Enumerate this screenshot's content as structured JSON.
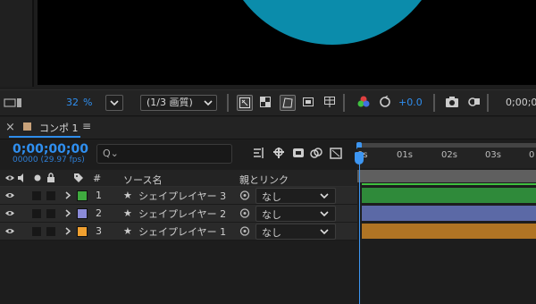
{
  "viewer_toolbar": {
    "zoom_value": "32",
    "zoom_unit": "%",
    "resolution": "(1/3 画質)",
    "exposure": "+0.0",
    "timecode": "0;00;00"
  },
  "panel": {
    "tab_label": "コンポ 1",
    "menu_glyph": "≡",
    "close_glyph": "×"
  },
  "time": {
    "current": "0;00;00;00",
    "frames": "00000 (29.97 fps)"
  },
  "search": {
    "placeholder": "Q⌄"
  },
  "columns": {
    "number": "#",
    "source_name": "ソース名",
    "parent_link": "親とリンク"
  },
  "layers": [
    {
      "number": "1",
      "name": "シェイプレイヤー 3",
      "parent": "なし",
      "label_color": "#3faa3f",
      "bar_color": "#2f8a3a"
    },
    {
      "number": "2",
      "name": "シェイプレイヤー 2",
      "parent": "なし",
      "label_color": "#8b8bd8",
      "bar_color": "#5b69a6"
    },
    {
      "number": "3",
      "name": "シェイプレイヤー 1",
      "parent": "なし",
      "label_color": "#f0a030",
      "bar_color": "#b07424"
    }
  ],
  "ruler": {
    "ticks": [
      "0s",
      "01s",
      "02s",
      "03s",
      "0"
    ]
  },
  "colors": {
    "accent": "#2f8ff0",
    "comp_circle": "#0b8cab"
  }
}
